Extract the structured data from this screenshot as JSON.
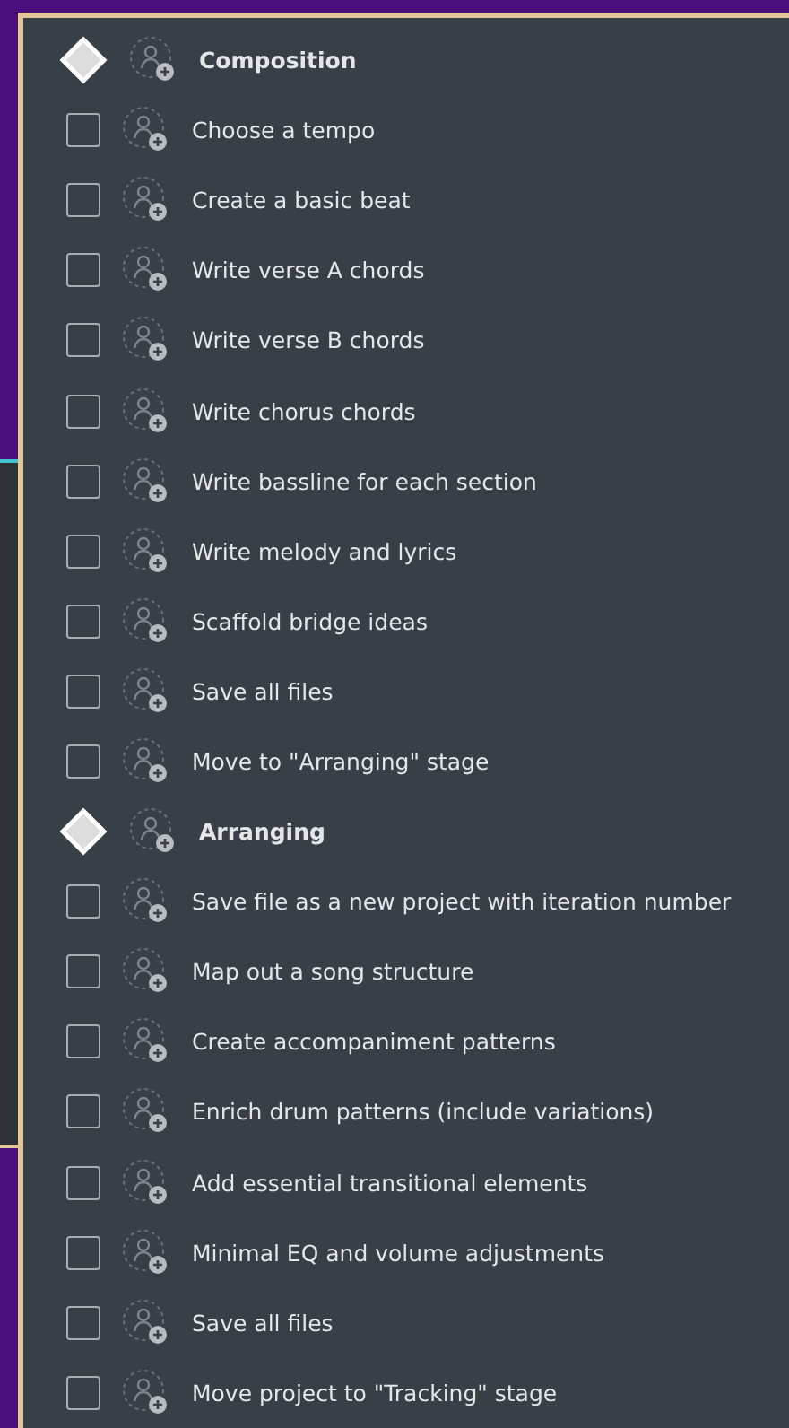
{
  "sections": [
    {
      "title": "Composition",
      "items": [
        {
          "label": "Choose a tempo",
          "checked": false
        },
        {
          "label": "Create a basic beat",
          "checked": false
        },
        {
          "label": "Write verse A chords",
          "checked": false
        },
        {
          "label": "Write verse B chords",
          "checked": false
        },
        {
          "label": "Write chorus chords",
          "checked": false
        },
        {
          "label": "Write bassline for each section",
          "checked": false
        },
        {
          "label": "Write melody and lyrics",
          "checked": false
        },
        {
          "label": "Scaffold bridge ideas",
          "checked": false
        },
        {
          "label": "Save all files",
          "checked": false
        },
        {
          "label": "Move to \"Arranging\" stage",
          "checked": false
        }
      ]
    },
    {
      "title": "Arranging",
      "items": [
        {
          "label": "Save file as a new project with iteration number",
          "checked": false
        },
        {
          "label": "Map out a song structure",
          "checked": false
        },
        {
          "label": "Create accompaniment patterns",
          "checked": false
        },
        {
          "label": "Enrich drum patterns (include variations)",
          "checked": false
        },
        {
          "label": "Add essential transitional elements",
          "checked": false
        },
        {
          "label": "Minimal EQ and volume adjustments",
          "checked": false
        },
        {
          "label": "Save all files",
          "checked": false
        },
        {
          "label": "Move project to \"Tracking\" stage",
          "checked": false
        }
      ]
    }
  ]
}
